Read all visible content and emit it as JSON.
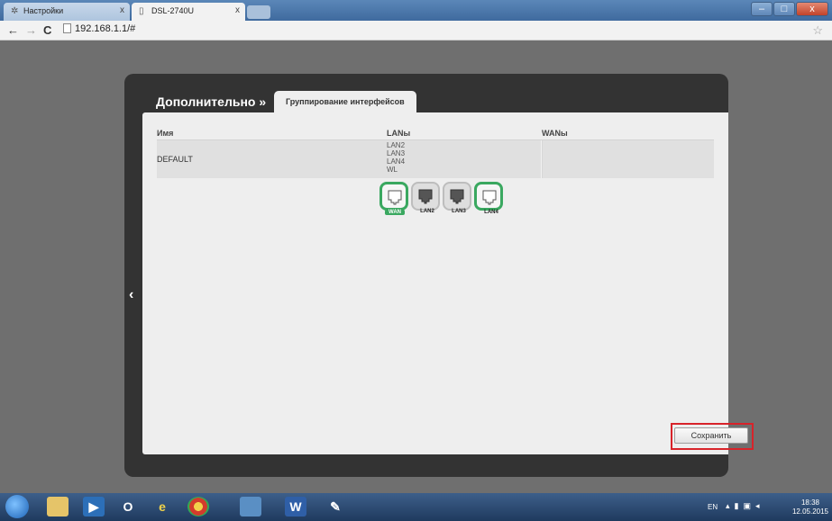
{
  "browser": {
    "tabs": [
      {
        "label": "Настройки",
        "icon": "gear-icon"
      },
      {
        "label": "DSL-2740U",
        "icon": "page-icon"
      }
    ],
    "url": "192.168.1.1/#",
    "nav": {
      "back": "←",
      "forward": "→",
      "reload": "C"
    },
    "window_buttons": {
      "minimize": "–",
      "maximize": "□",
      "close": "x"
    }
  },
  "page": {
    "breadcrumb_title": "Дополнительно »",
    "section_tab": "Группирование интерфейсов",
    "table": {
      "headers": {
        "name": "Имя",
        "lans": "LANы",
        "wans": "WANы"
      },
      "rows": [
        {
          "name": "DEFAULT",
          "lans": [
            "LAN2",
            "LAN3",
            "LAN4",
            "WL"
          ],
          "wans": ""
        }
      ]
    },
    "ports": [
      {
        "label": "WAN",
        "state": "active"
      },
      {
        "label": "LAN2",
        "state": "inactive"
      },
      {
        "label": "LAN3",
        "state": "inactive"
      },
      {
        "label": "LAN4",
        "state": "active"
      }
    ],
    "save_label": "Сохранить",
    "back_glyph": "‹"
  },
  "taskbar": {
    "language": "EN",
    "time": "18:38",
    "date": "12.05.2015"
  },
  "colors": {
    "port_active": "#3aa860",
    "highlight": "#d8232a",
    "frame": "#333333"
  }
}
